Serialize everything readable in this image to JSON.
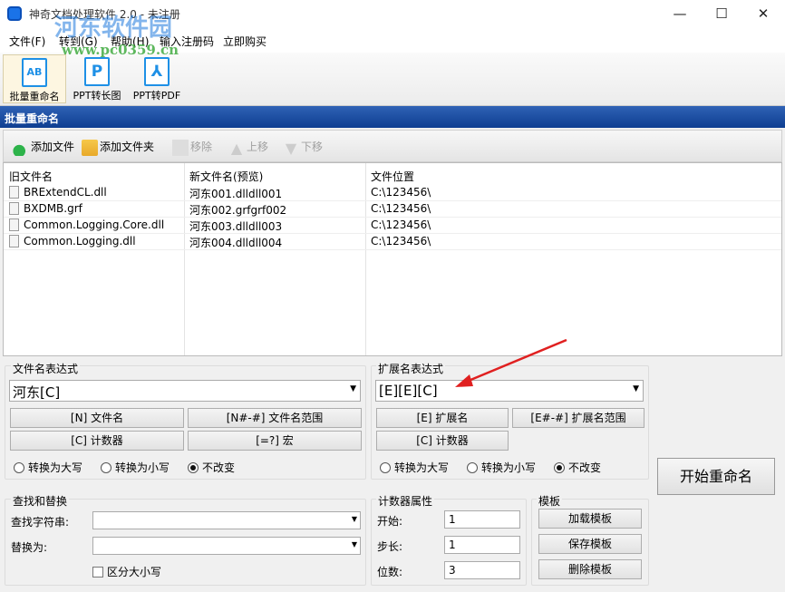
{
  "window": {
    "title": "神奇文档处理软件 2.0 - 未注册",
    "minimize": "—",
    "maximize": "☐",
    "close": "✕"
  },
  "watermark": {
    "text": "河东软件园",
    "url": "www.pc0359.cn"
  },
  "menu": [
    "文件(F)",
    "转到(G)",
    "帮助(H)",
    "输入注册码",
    "立即购买"
  ],
  "toolbar": [
    {
      "label": "批量重命名",
      "icon": "rename-icon",
      "glyph": "AB"
    },
    {
      "label": "PPT转长图",
      "icon": "ppt-icon",
      "glyph": "P"
    },
    {
      "label": "PPT转PDF",
      "icon": "pdf-icon",
      "glyph": "⅄"
    }
  ],
  "section_title": "批量重命名",
  "subtoolbar": {
    "add_file": "添加文件",
    "add_folder": "添加文件夹",
    "remove": "移除",
    "move_up": "上移",
    "move_down": "下移"
  },
  "list": {
    "headers": [
      "旧文件名",
      "新文件名(预览)",
      "文件位置"
    ],
    "rows": [
      {
        "old": "BRExtendCL.dll",
        "new": "河东001.dlldll001",
        "path": "C:\\123456\\"
      },
      {
        "old": "BXDMB.grf",
        "new": "河东002.grfgrf002",
        "path": "C:\\123456\\"
      },
      {
        "old": "Common.Logging.Core.dll",
        "new": "河东003.dlldll003",
        "path": "C:\\123456\\"
      },
      {
        "old": "Common.Logging.dll",
        "new": "河东004.dlldll004",
        "path": "C:\\123456\\"
      }
    ]
  },
  "filename_expr": {
    "label": "文件名表达式",
    "value": "河东[C]",
    "btn_name": "[N] 文件名",
    "btn_range": "[N#-#] 文件名范围",
    "btn_counter": "[C] 计数器",
    "btn_macro": "[=?] 宏",
    "upper": "转换为大写",
    "lower": "转换为小写",
    "keep": "不改变",
    "selected": "keep"
  },
  "ext_expr": {
    "label": "扩展名表达式",
    "value": "[E][E][C]",
    "btn_ext": "[E] 扩展名",
    "btn_range": "[E#-#] 扩展名范围",
    "btn_counter": "[C] 计数器",
    "upper": "转换为大写",
    "lower": "转换为小写",
    "keep": "不改变",
    "selected": "keep"
  },
  "find_replace": {
    "label": "查找和替换",
    "find_label": "查找字符串:",
    "find_value": "",
    "replace_label": "替换为:",
    "replace_value": "",
    "case_label": "区分大小写",
    "case_checked": false
  },
  "counter": {
    "label": "计数器属性",
    "start_label": "开始:",
    "start": "1",
    "step_label": "步长:",
    "step": "1",
    "digits_label": "位数:",
    "digits": "3"
  },
  "template": {
    "label": "模板",
    "load": "加载模板",
    "save": "保存模板",
    "delete": "删除模板"
  },
  "start_button": "开始重命名",
  "colors": {
    "header_blue": "#0e3e91",
    "arrow_red": "#e02020",
    "icon_blue": "#1e90e6"
  }
}
